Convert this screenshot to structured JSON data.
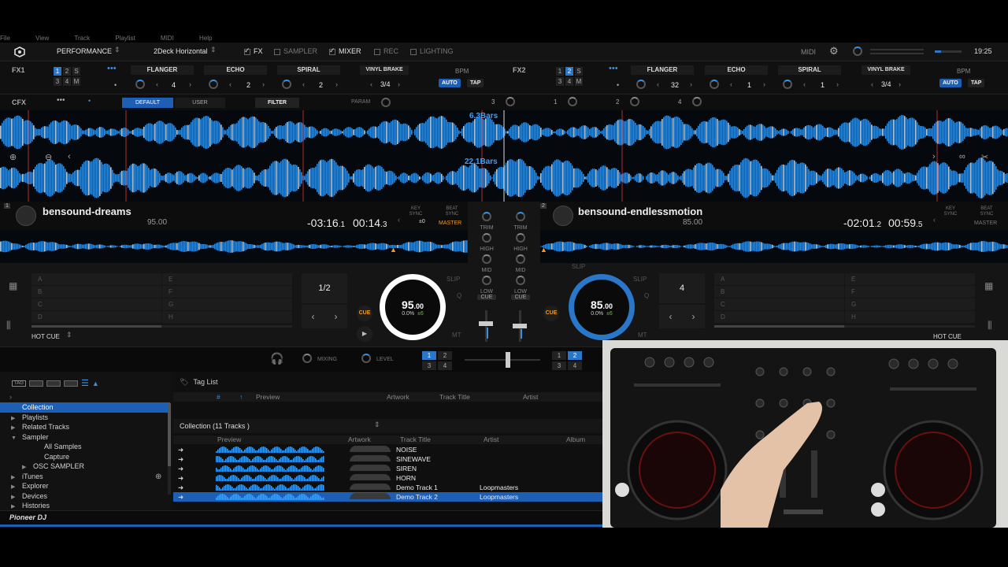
{
  "menubar": {
    "items": [
      "File",
      "View",
      "Track",
      "Playlist",
      "MIDI",
      "Help"
    ]
  },
  "topbar": {
    "mode": "PERFORMANCE",
    "layout": "2Deck Horizontal",
    "fx_label": "FX",
    "sampler_label": "SAMPLER",
    "mixer_label": "MIXER",
    "rec_label": "REC",
    "lighting_label": "LIGHTING",
    "midi_label": "MIDI",
    "clock": "19:25"
  },
  "fx1": {
    "label": "FX1",
    "assign": [
      "1",
      "2",
      "S",
      "3",
      "4",
      "M"
    ],
    "slots": [
      {
        "name": "FLANGER",
        "value": "4"
      },
      {
        "name": "ECHO",
        "value": "2"
      },
      {
        "name": "SPIRAL",
        "value": "2"
      }
    ],
    "beat_fx": "VINYL BRAKE",
    "beat": "3/4",
    "bpm_label": "BPM",
    "auto_label": "AUTO",
    "tap_label": "TAP"
  },
  "fx2": {
    "label": "FX2",
    "assign": [
      "1",
      "2",
      "S",
      "3",
      "4",
      "M"
    ],
    "slots": [
      {
        "name": "FLANGER",
        "value": "32"
      },
      {
        "name": "ECHO",
        "value": "1"
      },
      {
        "name": "SPIRAL",
        "value": "1"
      }
    ],
    "beat_fx": "VINYL BRAKE",
    "beat": "3/4",
    "bpm_label": "BPM",
    "auto_label": "AUTO",
    "tap_label": "TAP"
  },
  "cfx": {
    "label": "CFX",
    "default_tab": "DEFAULT",
    "user_tab": "USER",
    "filter_label": "FILTER",
    "param_label": "PARAM",
    "channels": [
      "3",
      "1",
      "2",
      "4"
    ]
  },
  "waves": {
    "top_bars": "6.3Bars",
    "bottom_bars": "22.1Bars"
  },
  "deck1": {
    "number": "1",
    "title": "bensound-dreams",
    "bpm_small": "95.00",
    "remain_main": "-03:16",
    "remain_frac": ".1",
    "elapsed_main": "00:14",
    "elapsed_frac": ".3",
    "key_sync_label": "KEY SYNC",
    "key_value": "±0",
    "beat_sync_label": "BEAT SYNC",
    "master_label": "MASTER",
    "pads": [
      "A",
      "E",
      "B",
      "F",
      "C",
      "G",
      "D",
      "H"
    ],
    "loop_value": "1/2",
    "jog_bpm": "95",
    "jog_bpm_frac": ".00",
    "pitch": "0.0%",
    "pitch_range": "±6",
    "cue_label": "CUE",
    "slip_label": "SLIP",
    "q_label": "Q",
    "mt_label": "MT",
    "hotcue_label": "HOT CUE"
  },
  "deck2": {
    "number": "2",
    "title": "bensound-endlessmotion",
    "bpm_small": "85.00",
    "remain_main": "-02:01",
    "remain_frac": ".2",
    "elapsed_main": "00:59",
    "elapsed_frac": ".5",
    "key_sync_label": "KEY SYNC",
    "beat_sync_label": "BEAT SYNC",
    "master_label": "MASTER",
    "pads": [
      "A",
      "E",
      "B",
      "F",
      "C",
      "G",
      "D",
      "H"
    ],
    "loop_value": "4",
    "jog_bpm": "85",
    "jog_bpm_frac": ".00",
    "pitch": "0.0%",
    "pitch_range": "±6",
    "cue_label": "CUE",
    "slip_label": "SLIP",
    "q_label": "Q",
    "mt_label": "MT",
    "hotcue_label": "HOT CUE"
  },
  "mixer": {
    "trim": "TRIM",
    "high": "HIGH",
    "mid": "MID",
    "low": "LOW",
    "cue": "CUE"
  },
  "midbar": {
    "mixing_label": "MIXING",
    "level_label": "LEVEL",
    "left_assign": [
      "1",
      "2",
      "3",
      "4"
    ],
    "right_assign": [
      "1",
      "2",
      "3",
      "4"
    ]
  },
  "browser": {
    "tree": [
      {
        "label": "Collection",
        "active": true,
        "arrow": ""
      },
      {
        "label": "Playlists",
        "arrow": "▶"
      },
      {
        "label": "Related Tracks",
        "arrow": "▶"
      },
      {
        "label": "Sampler",
        "arrow": "▼"
      },
      {
        "label": "All Samples",
        "arrow": "",
        "indent": 2
      },
      {
        "label": "Capture",
        "arrow": "",
        "indent": 2
      },
      {
        "label": "OSC SAMPLER",
        "arrow": "▶",
        "indent": 1
      },
      {
        "label": "iTunes",
        "arrow": "▶"
      },
      {
        "label": "Explorer",
        "arrow": "▶"
      },
      {
        "label": "Devices",
        "arrow": "▶"
      },
      {
        "label": "Histories",
        "arrow": "▶"
      }
    ],
    "tag_list_label": "Tag List",
    "tag_headers": [
      "#",
      "Preview",
      "Artwork",
      "Track Title",
      "Artist"
    ],
    "collection_label": "Collection (11 Tracks )",
    "list_headers": [
      "Preview",
      "Artwork",
      "Track Title",
      "Artist",
      "Album"
    ],
    "tracks": [
      {
        "title": "NOISE",
        "artist": ""
      },
      {
        "title": "SINEWAVE",
        "artist": ""
      },
      {
        "title": "SIREN",
        "artist": ""
      },
      {
        "title": "HORN",
        "artist": ""
      },
      {
        "title": "Demo Track 1",
        "artist": "Loopmasters"
      },
      {
        "title": "Demo Track 2",
        "artist": "Loopmasters",
        "selected": true
      }
    ]
  },
  "footer": {
    "brand": "Pioneer DJ"
  },
  "colors": {
    "accent": "#2a76c9",
    "orange": "#f39a20",
    "wave": "#3aa0ff"
  }
}
